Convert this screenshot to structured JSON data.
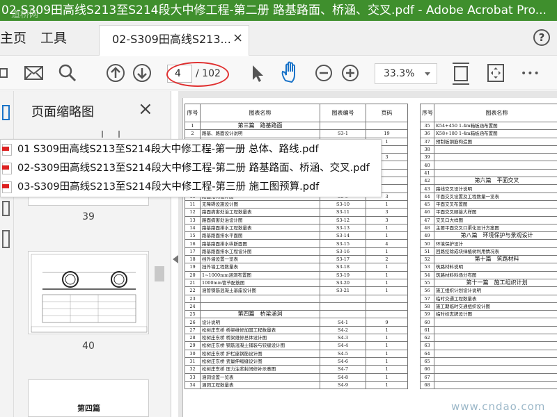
{
  "window": {
    "title": "02-S309田高线S213至S214段大中修工程-第二册 路基路面、桥涵、交叉.pdf - Adobe Acrobat Pro...",
    "corner_watermark": "道桥网"
  },
  "tabs": {
    "home_label": "主页",
    "tools_label": "工具",
    "doc_tab_label": "02-S309田高线S213...",
    "close_glyph": "×",
    "help_glyph": "?"
  },
  "toolbar": {
    "current_page": "4",
    "total_pages": "/ 102",
    "zoom": "33.3%",
    "more_glyph": "•••"
  },
  "thumbnail_panel": {
    "title": "页面缩略图",
    "close_glyph": "×",
    "thumbs": [
      {
        "label": "39"
      },
      {
        "label": "40"
      },
      {
        "label": "第四篇"
      }
    ]
  },
  "file_list": [
    "01 S309田高线S213至S214段大中修工程-第一册 总体、路线.pdf",
    "02-S309田高线S213至S214段大中修工程-第二册 路基路面、桥涵、交叉.pdf",
    "03-S309田高线S213至S214段大中修工程-第三册 施工图预算.pdf"
  ],
  "toc_headers": {
    "no": "序号",
    "name": "图表名称",
    "code": "图表编号",
    "pages": "页码"
  },
  "toc_left": [
    {
      "no": "1",
      "name": "第三篇　路基路面",
      "code": "",
      "pg": "",
      "sec": true
    },
    {
      "no": "2",
      "name": "路基、路面设计说明",
      "code": "S3-1",
      "pg": "19"
    },
    {
      "no": "3",
      "name": "",
      "code": "S3-2",
      "pg": "1"
    },
    {
      "no": "4",
      "name": "",
      "code": "",
      "pg": ""
    },
    {
      "no": "5",
      "name": "",
      "code": "",
      "pg": "3"
    },
    {
      "no": "6",
      "name": "",
      "code": "",
      "pg": ""
    },
    {
      "no": "7",
      "name": "",
      "code": "",
      "pg": ""
    },
    {
      "no": "8",
      "name": "",
      "code": "",
      "pg": ""
    },
    {
      "no": "9",
      "name": "",
      "code": "",
      "pg": ""
    },
    {
      "no": "10",
      "name": "路面结构设计图",
      "code": "S3-9",
      "pg": "3"
    },
    {
      "no": "11",
      "name": "无障碍设施设计图",
      "code": "S3-10",
      "pg": "1"
    },
    {
      "no": "12",
      "name": "路面病害处治工程数量表",
      "code": "S3-11",
      "pg": "3"
    },
    {
      "no": "13",
      "name": "路面病害处治设计图",
      "code": "S3-12",
      "pg": "3"
    },
    {
      "no": "14",
      "name": "路基路面排水工程数量表",
      "code": "S3-13",
      "pg": "1"
    },
    {
      "no": "15",
      "name": "路基路面排水平面图",
      "code": "S3-14",
      "pg": "1"
    },
    {
      "no": "16",
      "name": "路基路面排水纵断面图",
      "code": "S3-15",
      "pg": "4"
    },
    {
      "no": "17",
      "name": "路基路面排水工程设计图",
      "code": "S3-16",
      "pg": "1"
    },
    {
      "no": "18",
      "name": "挡外墙设置一览表",
      "code": "S3-17",
      "pg": "2"
    },
    {
      "no": "19",
      "name": "挡外墙工程数量表",
      "code": "S3-18",
      "pg": "1"
    },
    {
      "no": "20",
      "name": "1~1000mm涵洞布置图",
      "code": "S3-19",
      "pg": "1"
    },
    {
      "no": "21",
      "name": "1000mm管节配筋图",
      "code": "S3-20",
      "pg": "1"
    },
    {
      "no": "22",
      "name": "涵管钢筋混凝土基座设计图",
      "code": "S3-21",
      "pg": "1"
    },
    {
      "no": "23",
      "name": "",
      "code": "",
      "pg": ""
    },
    {
      "no": "24",
      "name": "",
      "code": "",
      "pg": ""
    },
    {
      "no": "25",
      "name": "第四篇　桥梁涵洞",
      "code": "",
      "pg": "",
      "sec": true
    },
    {
      "no": "26",
      "name": "设计说明",
      "code": "S4-1",
      "pg": "9"
    },
    {
      "no": "27",
      "name": "松树庄东桥 桥梁维修加固工程数量表",
      "code": "S4-2",
      "pg": "1"
    },
    {
      "no": "28",
      "name": "松树庄东桥 桥梁维修总体设计图",
      "code": "S4-3",
      "pg": "1"
    },
    {
      "no": "29",
      "name": "松树庄东桥 钢筋混凝土铺装与铰缝设计图",
      "code": "S4-4",
      "pg": "1"
    },
    {
      "no": "30",
      "name": "松树庄东桥 护栏座钢筋设计图",
      "code": "S4-5",
      "pg": "1"
    },
    {
      "no": "31",
      "name": "松树庄东桥 瓷量伸缩缝设计图",
      "code": "S4-6",
      "pg": "1"
    },
    {
      "no": "32",
      "name": "松树庄东桥 压力注浆封闭修补示意图",
      "code": "S4-7",
      "pg": "1"
    },
    {
      "no": "33",
      "name": "涵洞设置一览表",
      "code": "S4-8",
      "pg": "1"
    },
    {
      "no": "34",
      "name": "涵洞工程数量表",
      "code": "S4-9",
      "pg": "1"
    }
  ],
  "toc_right": [
    {
      "no": "35",
      "name": "K54+450 1-4m箱板涵布置图",
      "sec": false
    },
    {
      "no": "36",
      "name": "K58+180 1-4m箱板涵布置图",
      "sec": false
    },
    {
      "no": "37",
      "name": "预制板钢筋构造图",
      "sec": false
    },
    {
      "no": "38",
      "name": "",
      "sec": false
    },
    {
      "no": "39",
      "name": "",
      "sec": false
    },
    {
      "no": "40",
      "name": "",
      "sec": false
    },
    {
      "no": "41",
      "name": "",
      "sec": false
    },
    {
      "no": "42",
      "name": "第六篇　平面交叉",
      "sec": true
    },
    {
      "no": "43",
      "name": "路线交叉设计说明",
      "sec": false
    },
    {
      "no": "44",
      "name": "平面交叉设置及工程数量一览表",
      "sec": false
    },
    {
      "no": "45",
      "name": "平面交叉布置图",
      "sec": false
    },
    {
      "no": "46",
      "name": "平面交叉顺接大样图",
      "sec": false
    },
    {
      "no": "47",
      "name": "交叉口大样图",
      "sec": false
    },
    {
      "no": "48",
      "name": "主要平面交叉口渠化设计方案图",
      "sec": false
    },
    {
      "no": "49",
      "name": "第八篇　环境保护与景观设计",
      "sec": true
    },
    {
      "no": "50",
      "name": "环境保护设计",
      "sec": false
    },
    {
      "no": "51",
      "name": "回路挖除成块绿植树利用情况表",
      "sec": false
    },
    {
      "no": "52",
      "name": "第十篇　筑路材料",
      "sec": true
    },
    {
      "no": "53",
      "name": "筑路材料说明",
      "sec": false
    },
    {
      "no": "54",
      "name": "筑路材料料场分布图",
      "sec": false
    },
    {
      "no": "55",
      "name": "第十一篇　施工组织计划",
      "sec": true
    },
    {
      "no": "56",
      "name": "施工组织计划设计说明",
      "sec": false
    },
    {
      "no": "57",
      "name": "临时交通工程数量表",
      "sec": false
    },
    {
      "no": "58",
      "name": "施工期临时交通组织设计图",
      "sec": false
    },
    {
      "no": "59",
      "name": "临时标志牌设计图",
      "sec": false
    },
    {
      "no": "60",
      "name": "",
      "sec": false
    },
    {
      "no": "61",
      "name": "",
      "sec": false
    },
    {
      "no": "62",
      "name": "",
      "sec": false
    },
    {
      "no": "63",
      "name": "",
      "sec": false
    },
    {
      "no": "64",
      "name": "",
      "sec": false
    },
    {
      "no": "65",
      "name": "",
      "sec": false
    },
    {
      "no": "66",
      "name": "",
      "sec": false
    },
    {
      "no": "67",
      "name": "",
      "sec": false
    },
    {
      "no": "68",
      "name": "",
      "sec": false
    }
  ],
  "site_watermark": "www.cndao.com",
  "colors": {
    "titlebar": "#3f8f2d",
    "highlight_ellipse": "#e03030",
    "hand_tool": "#1a73c8"
  }
}
